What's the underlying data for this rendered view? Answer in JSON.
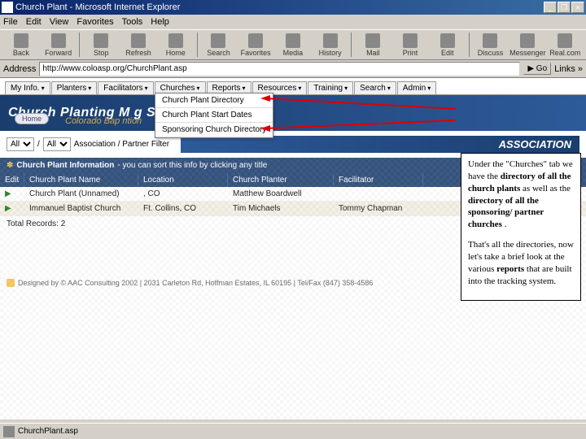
{
  "window": {
    "title": "Church Plant - Microsoft Internet Explorer",
    "minimize": "_",
    "restore": "❐",
    "close": "×"
  },
  "menubar": [
    "File",
    "Edit",
    "View",
    "Favorites",
    "Tools",
    "Help"
  ],
  "toolbar": [
    {
      "label": "Back"
    },
    {
      "label": "Forward"
    },
    {
      "label": "Stop"
    },
    {
      "label": "Refresh"
    },
    {
      "label": "Home"
    },
    {
      "label": "Search"
    },
    {
      "label": "Favorites"
    },
    {
      "label": "Media"
    },
    {
      "label": "History"
    },
    {
      "label": "Mail"
    },
    {
      "label": "Print"
    },
    {
      "label": "Edit"
    },
    {
      "label": "Discuss"
    },
    {
      "label": "Messenger"
    },
    {
      "label": "Real.com"
    }
  ],
  "addressbar": {
    "label": "Address",
    "url": "http://www.coloasp.org/ChurchPlant.asp",
    "go": "Go",
    "links": "Links »"
  },
  "tabs": [
    "My Info.",
    "Planters",
    "Facilitators",
    "Churches",
    "Reports",
    "Resources",
    "Training",
    "Search",
    "Admin"
  ],
  "dropdown": {
    "items": [
      "Church Plant Directory",
      "Church Plant Start Dates",
      "Sponsoring Church Directory"
    ]
  },
  "banner": {
    "title": "Church Planting M            g System",
    "subtitle": "Colorado Bap                         ntion",
    "home": "Home"
  },
  "filter": {
    "all1": "All",
    "slash": "/",
    "all2": "All",
    "label": "Association / Partner Filter",
    "assoc": "ASSOCIATION"
  },
  "section": {
    "icon": "✽",
    "title": "Church Plant Information",
    "hint": "- you can sort this info by clicking any title"
  },
  "columns": {
    "c1": "Edit",
    "c2": "Church Plant Name",
    "c3": "Location",
    "c4": "Church Planter",
    "c5": "Facilitator"
  },
  "rows": [
    {
      "name": "Church Plant (Unnamed)",
      "loc": ", CO",
      "planter": "Matthew Boardwell",
      "fac": ""
    },
    {
      "name": "Immanuel Baptist Church",
      "loc": "Ft. Collins, CO",
      "planter": "Tim Michaels",
      "fac": "Tommy Chapman"
    }
  ],
  "totals": {
    "label": "Total Records:",
    "value": "2"
  },
  "footer": {
    "text": "Designed by © AAC Consulting 2002 | 2031 Carleton Rd, Hoffman Estates, IL 60195 | Tel/Fax (847) 358-4586"
  },
  "annot": {
    "p1a": "Under the \"Churches\" tab we have the ",
    "p1b": "directory of all the church plants",
    "p1c": " as well as the ",
    "p1d": "directory of all the sponsoring/ partner churches",
    "p1e": ".",
    "p2a": "That's all the directories, now let's take a brief look at the various ",
    "p2b": "reports",
    "p2c": " that are built into the tracking system."
  },
  "statusbar": {
    "text": "ChurchPlant.asp"
  }
}
